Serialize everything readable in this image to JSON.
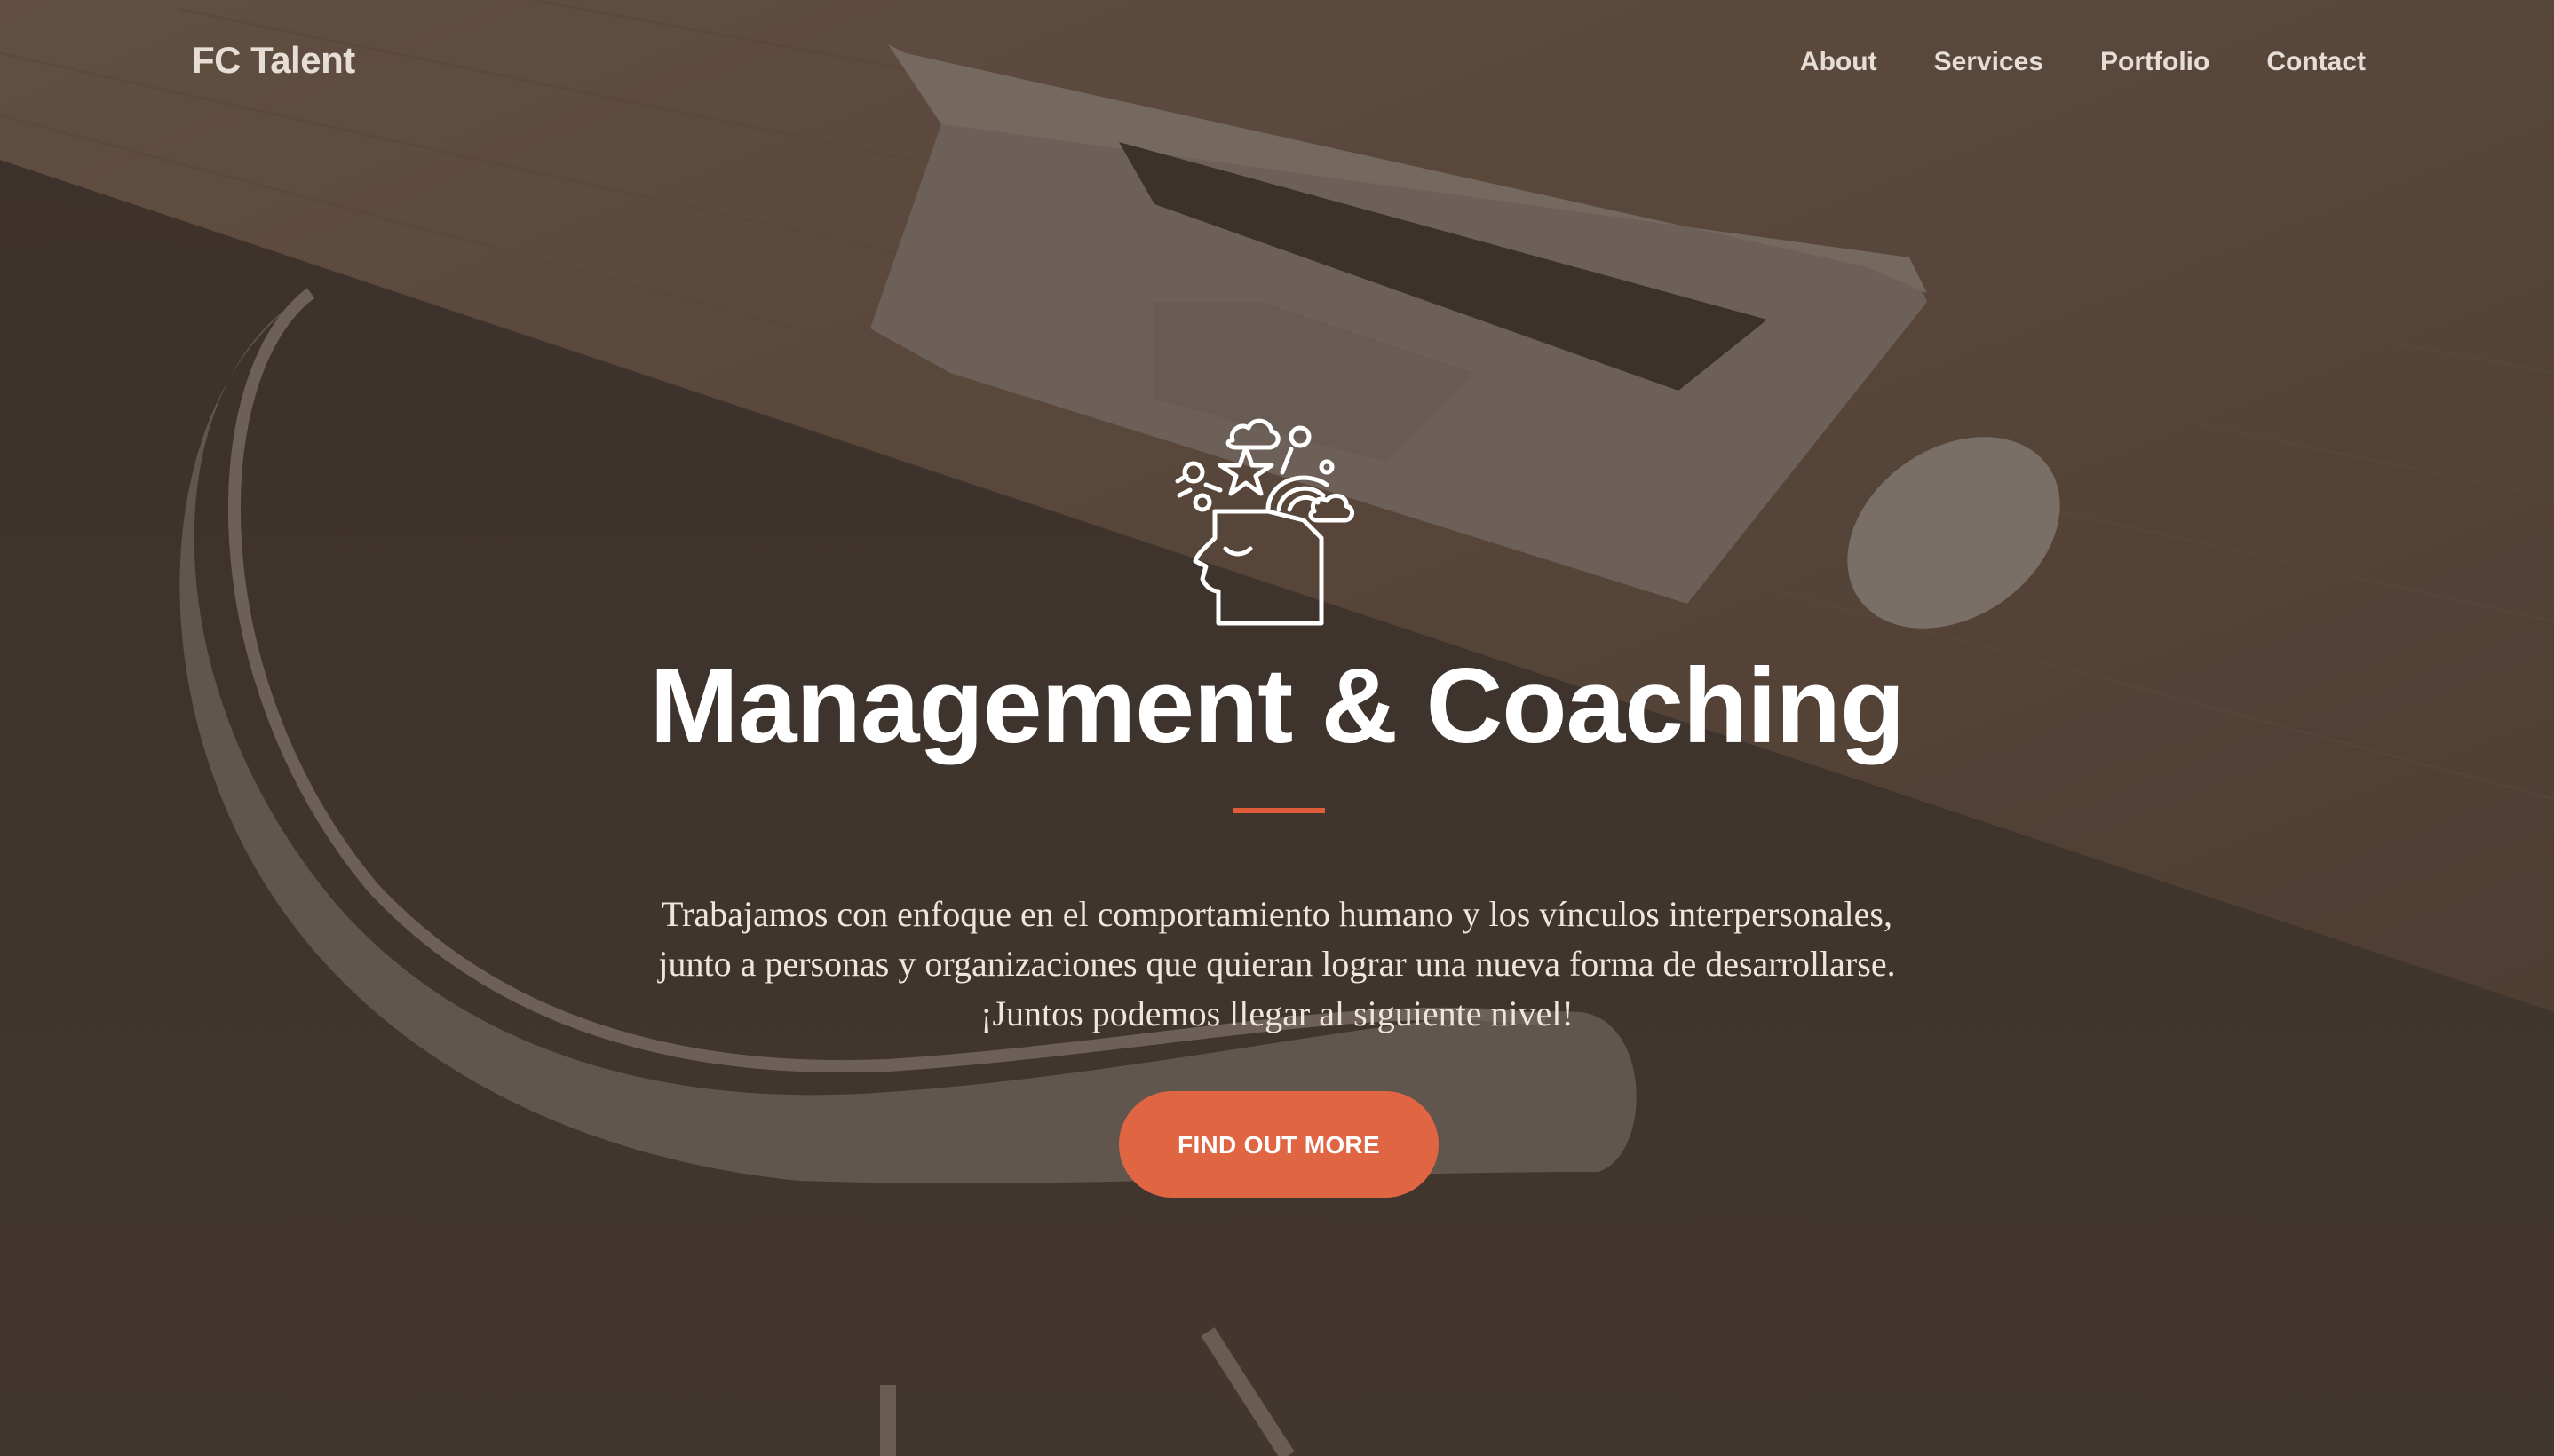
{
  "navbar": {
    "brand": "FC Talent",
    "links": [
      {
        "label": "About"
      },
      {
        "label": "Services"
      },
      {
        "label": "Portfolio"
      },
      {
        "label": "Contact"
      }
    ]
  },
  "hero": {
    "icon": "head-ideas-icon",
    "title": "Management & Coaching",
    "text_lines": [
      "Trabajamos con enfoque en el comportamiento humano y los vínculos interpersonales,",
      "junto a personas y organizaciones que quieran lograr una nueva forma de desarrollarse.",
      "¡Juntos podemos llegar al siguiente nivel!"
    ],
    "cta_label": "FIND OUT MORE"
  },
  "colors": {
    "accent": "#e06643",
    "overlay": "#3e322a",
    "text": "#ffffff"
  }
}
